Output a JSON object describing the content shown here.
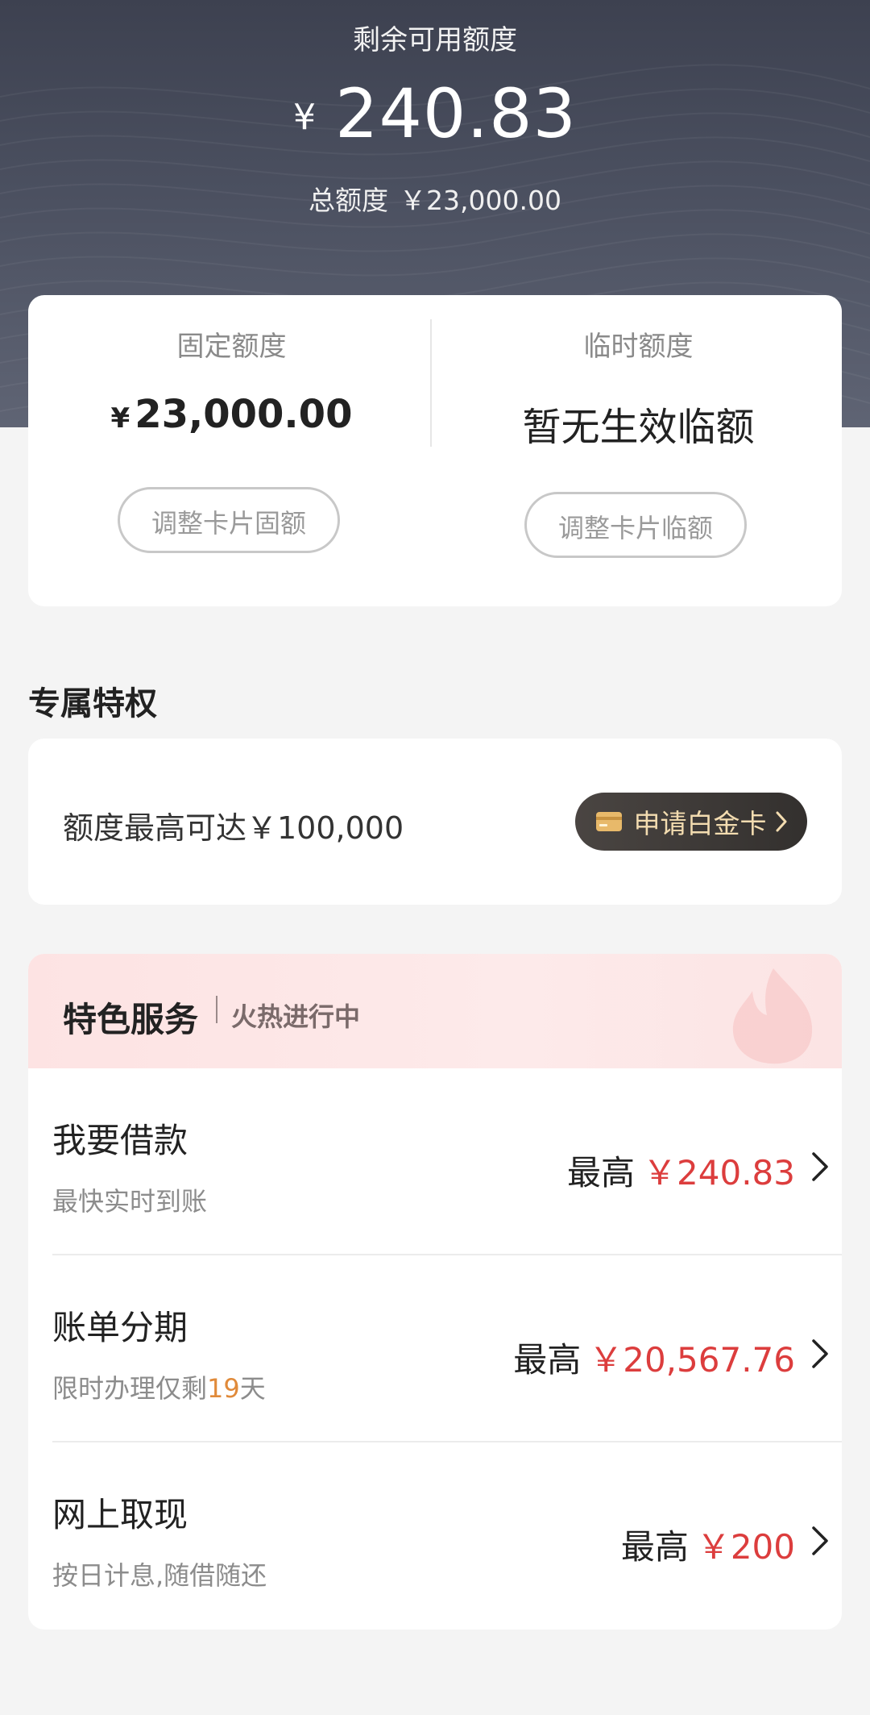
{
  "hero": {
    "label": "剩余可用额度",
    "currency": "¥",
    "available": "240.83",
    "total_label": "总额度",
    "total_value": "￥23,000.00"
  },
  "quota": {
    "fixed": {
      "title": "固定额度",
      "currency": "¥",
      "amount": "23,000.00",
      "button": "调整卡片固额"
    },
    "temporary": {
      "title": "临时额度",
      "status": "暂无生效临额",
      "button": "调整卡片临额"
    }
  },
  "privilege": {
    "section_title": "专属特权",
    "text": "额度最高可达￥100,000",
    "button": "申请白金卡",
    "button_icon": "card-icon",
    "button_color": "#3b3735",
    "button_text_color": "#f3dcb0"
  },
  "services": {
    "title": "特色服务",
    "subtitle": "火热进行中",
    "items": [
      {
        "title": "我要借款",
        "sub": "最快实时到账",
        "prefix": "最高",
        "amount": "￥240.83"
      },
      {
        "title": "账单分期",
        "sub_before": "限时办理仅剩",
        "sub_highlight": "19",
        "sub_after": "天",
        "prefix": "最高",
        "amount": "￥20,567.76"
      },
      {
        "title": "网上取现",
        "sub": "按日计息,随借随还",
        "prefix": "最高",
        "amount": "￥200"
      }
    ],
    "amount_color": "#dc3d3d",
    "highlight_color": "#e08a3a"
  }
}
